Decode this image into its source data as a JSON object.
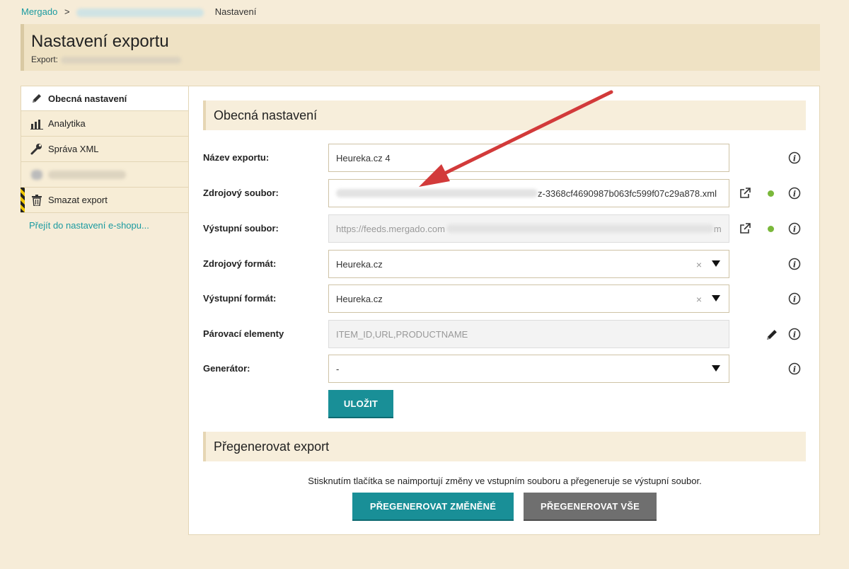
{
  "breadcrumb": {
    "home": "Mergado",
    "sep": ">",
    "current": "Nastavení"
  },
  "header": {
    "title": "Nastavení exportu",
    "export_label": "Export:"
  },
  "sidebar": {
    "items": [
      {
        "label": "Obecná nastavení",
        "icon": "pencil-icon"
      },
      {
        "label": "Analytika",
        "icon": "bar-chart-icon"
      },
      {
        "label": "Správa XML",
        "icon": "wrench-icon"
      },
      {
        "label": "",
        "icon": "blurred-icon"
      },
      {
        "label": "Smazat export",
        "icon": "trash-icon"
      }
    ],
    "link": "Přejít do nastavení e-shopu..."
  },
  "general": {
    "title": "Obecná nastavení",
    "fields": {
      "name": {
        "label": "Název exportu:",
        "value": "Heureka.cz 4"
      },
      "source": {
        "label": "Zdrojový soubor:",
        "value_tail": "z-3368cf4690987b063fc599f07c29a878.xml"
      },
      "output": {
        "label": "Výstupní soubor:",
        "value_head": "https://feeds.mergado.com",
        "value_tail": "m"
      },
      "source_format": {
        "label": "Zdrojový formát:",
        "value": "Heureka.cz",
        "clear": "×"
      },
      "output_format": {
        "label": "Výstupní formát:",
        "value": "Heureka.cz",
        "clear": "×"
      },
      "pairing": {
        "label": "Párovací elementy",
        "value": "ITEM_ID,URL,PRODUCTNAME"
      },
      "generator": {
        "label": "Generátor:",
        "value": "-"
      }
    },
    "save_label": "ULOŽIT"
  },
  "regen": {
    "title": "Přegenerovat export",
    "note": "Stisknutím tlačítka se naimportují změny ve vstupním souboru a přegeneruje se výstupní soubor.",
    "btn_changed": "PŘEGENEROVAT ZMĚNĚNÉ",
    "btn_all": "PŘEGENEROVAT VŠE"
  },
  "colors": {
    "accent": "#198f97",
    "status_ok": "#7ab83a",
    "annotation_arrow": "#d23a3a"
  }
}
